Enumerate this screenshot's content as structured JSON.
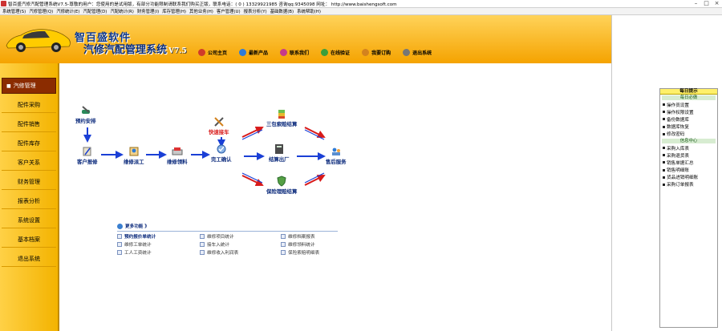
{
  "window": {
    "title": "智百盛汽修汽配管理系统V7.5-尊敬的用户：您使用的是试用版，有部分功能限制请联系我们购买正版，联系电话：( 0 ) 13329921985  咨询qq:9345098   网址：  http://www.baishengsoft.com",
    "min": "–",
    "max": "□",
    "close": "×"
  },
  "menu": [
    "系统管理(S)",
    "汽修管理(Q)",
    "汽修统计(E)",
    "汽配管理(D)",
    "汽配统计(R)",
    "财务管理(I)",
    "库存管理(H)",
    "其他业务(H)",
    "客户管理(U)",
    "报表分析(Y)",
    "基础数据(B)",
    "系统帮助(H)"
  ],
  "header": {
    "brand": "智百盛软件",
    "product": "汽修汽配管理系统",
    "version": "V7.5",
    "toolbar": [
      {
        "label": "公司主页",
        "icon": "home-icon",
        "color": "#d03a2a"
      },
      {
        "label": "最新产品",
        "icon": "product-icon",
        "color": "#2e7bd6"
      },
      {
        "label": "联系我们",
        "icon": "contact-icon",
        "color": "#c63b8a"
      },
      {
        "label": "在线验证",
        "icon": "verify-icon",
        "color": "#3b9e3b"
      },
      {
        "label": "我要订购",
        "icon": "order-icon",
        "color": "#d3821e"
      },
      {
        "label": "退出系统",
        "icon": "exit-icon",
        "color": "#777777"
      }
    ]
  },
  "sidebar": {
    "items": [
      {
        "label": "汽修管理",
        "active": true
      },
      {
        "label": "配件采购"
      },
      {
        "label": "配件销售"
      },
      {
        "label": "配件库存"
      },
      {
        "label": "客户关系"
      },
      {
        "label": "财务管理"
      },
      {
        "label": "报表分析"
      },
      {
        "label": "系统设置"
      },
      {
        "label": "基本档案"
      },
      {
        "label": "退出系统"
      }
    ],
    "bullet": "■"
  },
  "flow": {
    "nodes": {
      "booking": "预约安排",
      "reception": "客户报修",
      "dispatch": "维修派工",
      "material": "维修领料",
      "completion": "完工确认",
      "quick": "快速接车",
      "tripartite": "三包索赔结算",
      "settlement": "结算出厂",
      "insurance": "保险理赔结算",
      "aftersale": "售后服务"
    }
  },
  "more": {
    "title": "更多功能 》",
    "links": [
      "预约报价单统计",
      "维修项目统计",
      "维修档案报表",
      "维修工单统计",
      "接车入统计",
      "维修领料统计",
      "工人工资统计",
      "维修收入利润表",
      "保险索赔明细表"
    ]
  },
  "right": {
    "title": "每日提示",
    "sections": [
      {
        "title": "每日必做",
        "items": [
          "操作员设置",
          "操作权限设置",
          "备份数据库",
          "数据库恢复",
          "修改密码"
        ]
      },
      {
        "title": "信息中心",
        "items": [
          "采购入库表",
          "采购退货表",
          "销售单据汇总",
          "销售明细账",
          "货品进销明细账",
          "采购订单报表"
        ]
      }
    ]
  }
}
